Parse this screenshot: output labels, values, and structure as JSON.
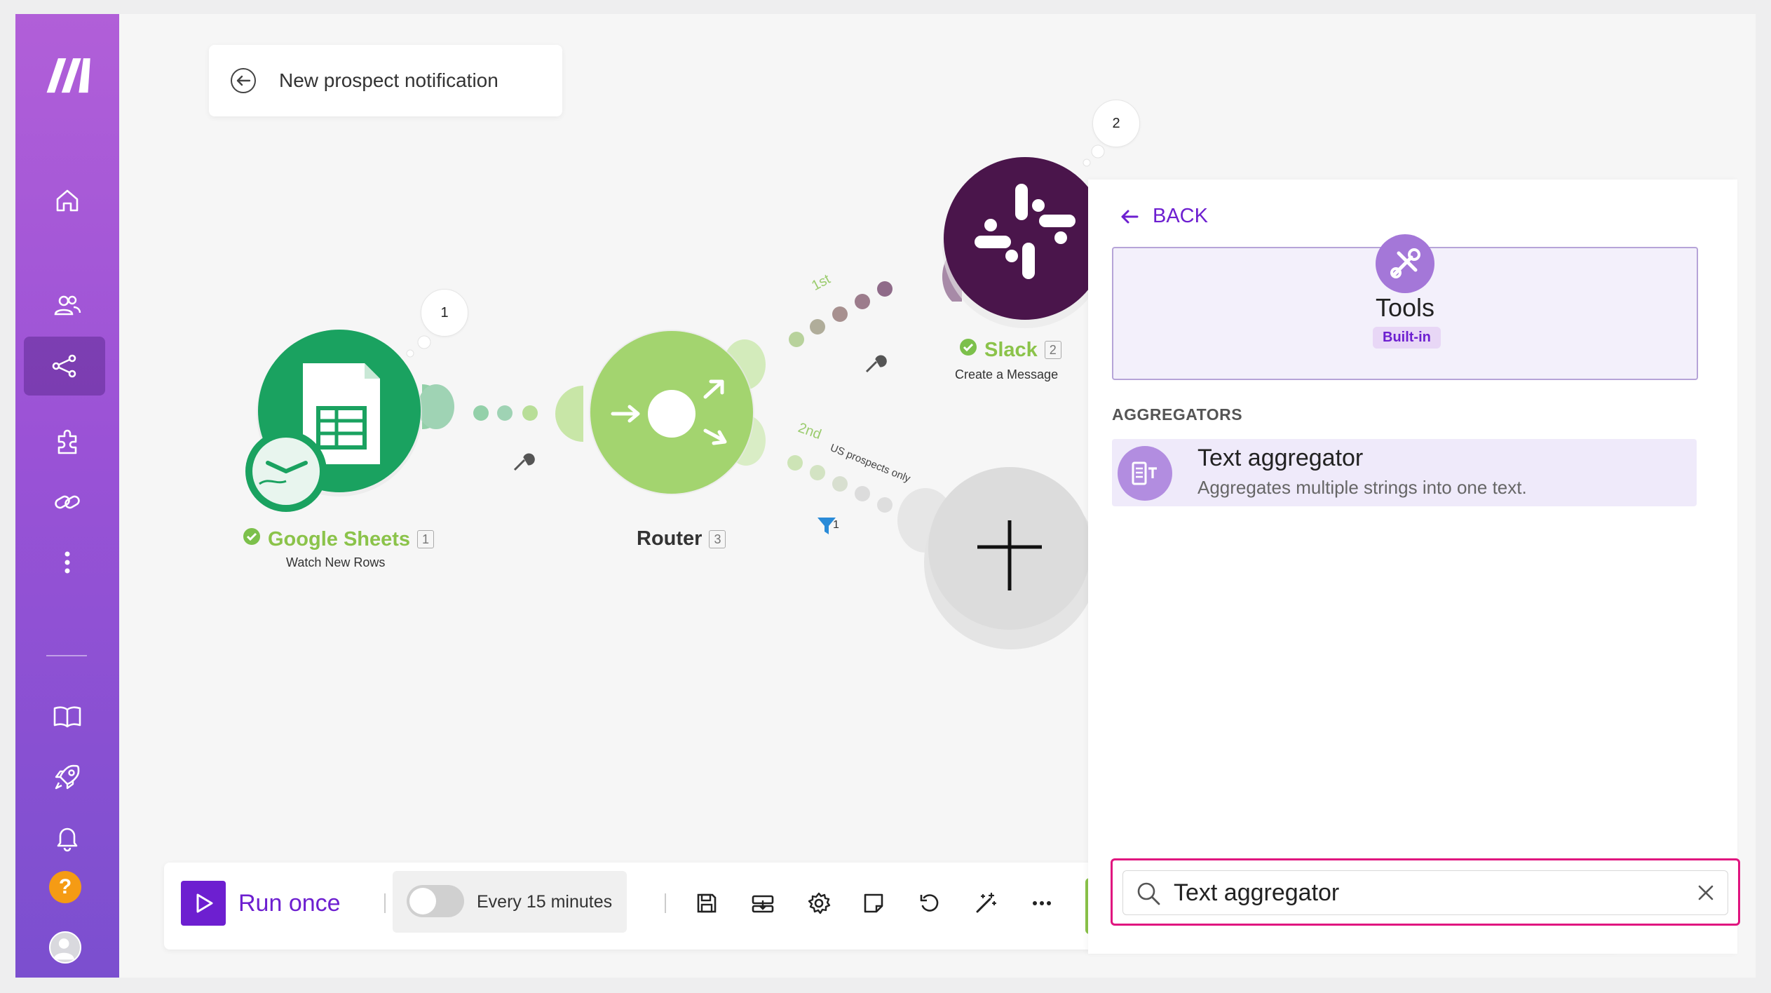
{
  "scenario": {
    "name": "New prospect notification"
  },
  "sidebar": {
    "items": [
      {
        "icon": "home-icon"
      },
      {
        "icon": "team-icon"
      },
      {
        "icon": "scenarios-icon",
        "active": true
      },
      {
        "icon": "apps-icon"
      },
      {
        "icon": "connections-icon"
      },
      {
        "icon": "more-icon"
      },
      {
        "icon": "docs-icon"
      },
      {
        "icon": "rocket-icon"
      },
      {
        "icon": "bell-icon"
      }
    ],
    "help_label": "?"
  },
  "modules": [
    {
      "name": "Google Sheets",
      "id": "1",
      "action": "Watch New Rows",
      "bubble": "1",
      "color": "#1aa260",
      "label_color": "#8bc34a"
    },
    {
      "name": "Router",
      "id": "3",
      "color": "#a3d46f",
      "label_color": "#333333"
    },
    {
      "name": "Slack",
      "id": "2",
      "action": "Create a Message",
      "bubble": "2",
      "color": "#4a154b",
      "label_color": "#8bc34a"
    }
  ],
  "routes": {
    "first": "1st",
    "second": "2nd",
    "second_filter": "US prospects only",
    "filter_count": "1"
  },
  "panel": {
    "back_label": "BACK",
    "app": {
      "name": "Tools",
      "tag": "Built-in"
    },
    "section": "AGGREGATORS",
    "results": [
      {
        "title": "Text aggregator",
        "description": "Aggregates multiple strings into one text."
      }
    ],
    "search": {
      "value": "Text aggregator",
      "placeholder": "Search"
    }
  },
  "toolbar": {
    "run_label": "Run once",
    "schedule_label": "Every 15 minutes",
    "schedule_enabled": false,
    "icons": [
      "save-icon",
      "export-icon",
      "settings-icon",
      "notes-icon",
      "undo-icon",
      "magic-wand-icon",
      "more-icon"
    ]
  },
  "colors": {
    "brand": "#6d1fd0",
    "sidebar_top": "#b15fd8",
    "sidebar_bottom": "#7b4fcf",
    "search_highlight": "#e0157f"
  }
}
